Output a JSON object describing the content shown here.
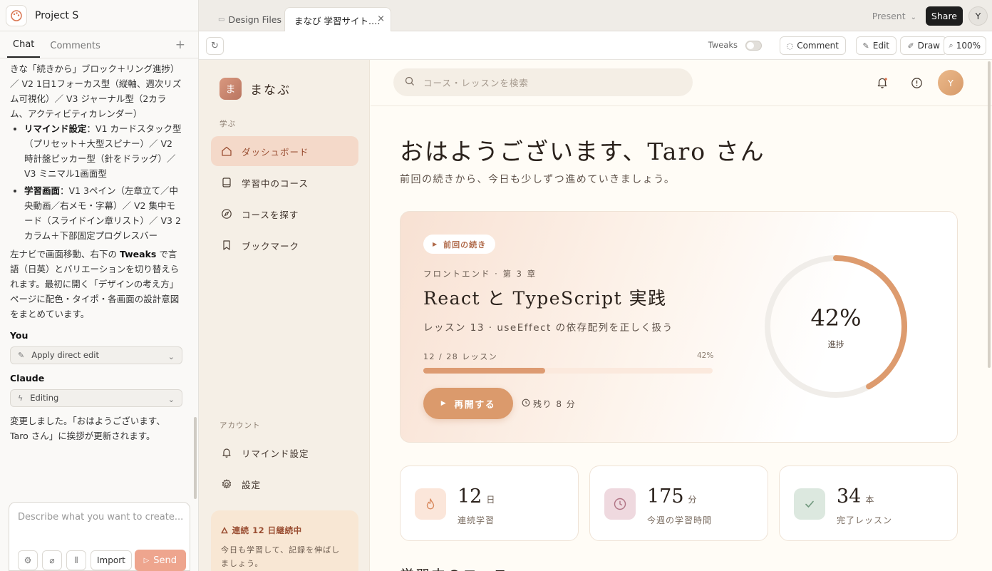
{
  "project": {
    "title": "Project S"
  },
  "chat": {
    "tabs": [
      "Chat",
      "Comments"
    ],
    "add_label": "+",
    "intro_line": "きな「続きから」ブロック＋リング進捗）／ V2 1日1フォーカス型（縦軸、週次リズム可視化）／ V3 ジャーナル型（2カラム、アクティビティカレンダー）",
    "bullets": [
      {
        "title": "リマインド設定",
        "text": "：V1 カードスタック型（プリセット＋大型スピナー）／ V2 時計盤ピッカー型（針をドラッグ）／ V3 ミニマル1画面型"
      },
      {
        "title": "学習画面",
        "text": "：V1 3ペイン（左章立て／中央動画／右メモ・字幕）／ V2 集中モード（スライドイン章リスト）／ V3 2カラム＋下部固定プログレスバー"
      }
    ],
    "para_before": "左ナビで画面移動、右下の ",
    "para_bold": "Tweaks",
    "para_after": " で言語（日英）とバリエーションを切り替えられます。最初に開く「デザインの考え方」ページに配色・タイポ・各画面の設計意図をまとめています。",
    "you_label": "You",
    "you_action": "Apply direct edit",
    "claude_label": "Claude",
    "claude_action": "Editing",
    "claude_reply": "変更しました。「おはようございます、Taro さん」に挨拶が更新されます。",
    "composer_placeholder": "Describe what you want to create...",
    "import_label": "Import",
    "send_label": "Send"
  },
  "tabs": {
    "design_files": "Design Files",
    "active": "まなび 学習サイト.…",
    "close": "×",
    "present": "Present",
    "share": "Share",
    "user_initial": "Y"
  },
  "toolbar": {
    "tweaks": "Tweaks",
    "comment": "Comment",
    "edit": "Edit",
    "draw": "Draw",
    "zoom": "100%"
  },
  "app": {
    "brand_mark": "ま",
    "brand_name": "まなぶ",
    "section_learn": "学ぶ",
    "nav": [
      {
        "label": "ダッシュボード",
        "icon": "home-icon"
      },
      {
        "label": "学習中のコース",
        "icon": "book-icon"
      },
      {
        "label": "コースを探す",
        "icon": "compass-icon"
      },
      {
        "label": "ブックマーク",
        "icon": "bookmark-icon"
      }
    ],
    "section_account": "アカウント",
    "account_nav": [
      {
        "label": "リマインド設定",
        "icon": "bell-icon"
      },
      {
        "label": "設定",
        "icon": "gear-icon"
      }
    ],
    "streak_title": "連続 12 日継続中",
    "streak_text": "今日も学習して、記録を伸ばしましょう。",
    "search_placeholder": "コース・レッスンを検索",
    "avatar_initial": "Y",
    "greeting": "おはようございます、Taro さん",
    "greeting_sub": "前回の続きから、今日も少しずつ進めていきましょう。",
    "hero": {
      "chip": "前回の続き",
      "meta": "フロントエンド · 第 3 章",
      "title": "React と TypeScript 実践",
      "lesson": "レッスン 13 · useEffect の依存配列を正しく扱う",
      "count": "12 / 28 レッスン",
      "pct_label": "42%",
      "progress": 0.42,
      "resume": "再開する",
      "remaining": "残り 8 分",
      "ring_value": "42%",
      "ring_label": "進捗"
    },
    "stats": [
      {
        "value": "12",
        "unit": "日",
        "label": "連続学習",
        "icon": "flame-icon",
        "bg": "#fbe6da",
        "color": "#d98a5f"
      },
      {
        "value": "175",
        "unit": "分",
        "label": "今週の学習時間",
        "icon": "clock-icon",
        "bg": "#efd9df",
        "color": "#b07384"
      },
      {
        "value": "34",
        "unit": "本",
        "label": "完了レッスン",
        "icon": "check-icon",
        "bg": "#dce8df",
        "color": "#6f977c"
      }
    ],
    "section_peek": "学習中のコース"
  },
  "colors": {
    "accent": "#db9a6c",
    "nav_active": "#f4d9c9",
    "send": "#eea58e"
  }
}
